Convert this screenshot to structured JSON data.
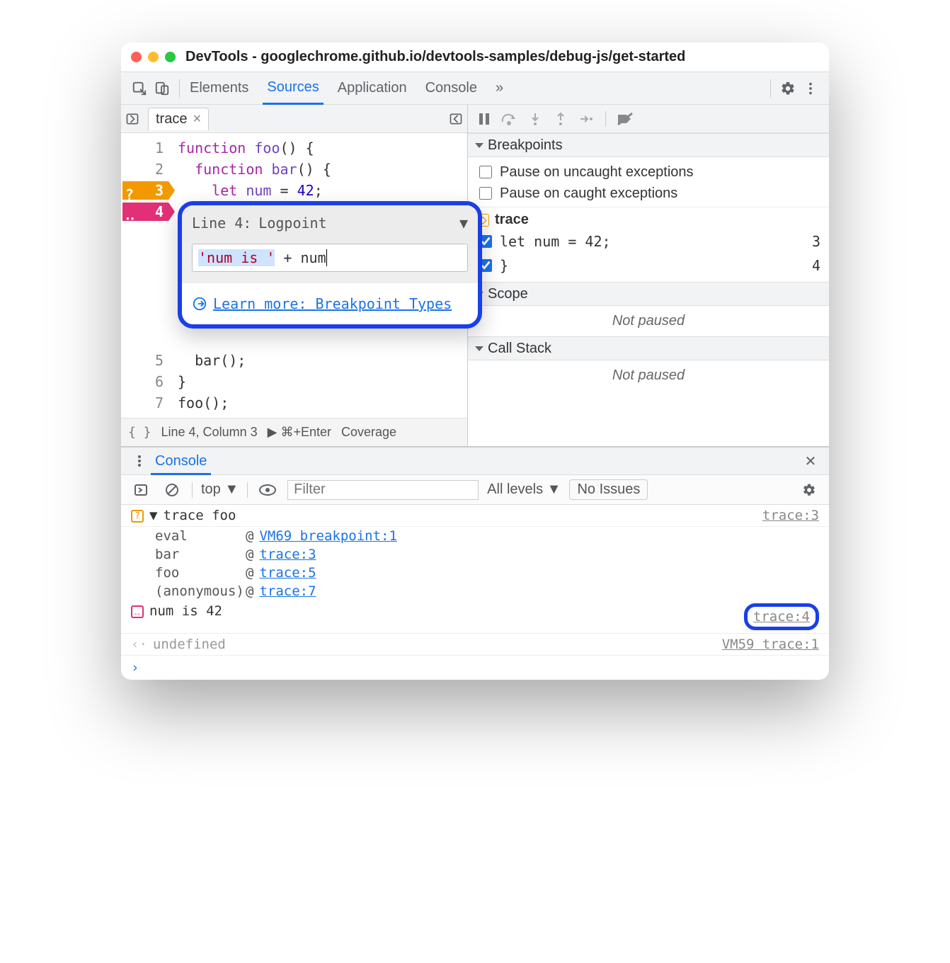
{
  "window": {
    "title": "DevTools - googlechrome.github.io/devtools-samples/debug-js/get-started"
  },
  "top_tabs": {
    "elements": "Elements",
    "sources": "Sources",
    "application": "Application",
    "console": "Console"
  },
  "file_tab": {
    "name": "trace"
  },
  "code": {
    "lines": [
      "1",
      "2",
      "3",
      "4",
      "5",
      "6",
      "7"
    ],
    "l1_kw": "function ",
    "l1_fn": "foo",
    "l1_rest": "() {",
    "l2_kw": "function ",
    "l2_fn": "bar",
    "l2_rest": "() {",
    "l3_kw": "let ",
    "l3_id": "num",
    "l3_eq": " = ",
    "l3_num": "42",
    "l3_semi": ";",
    "l4": "  }",
    "l5": "  bar();",
    "l6": "}",
    "l7": "foo();"
  },
  "popover": {
    "prefix": "Line 4:",
    "type": "Logpoint",
    "input_literal": "'num is '",
    "input_rest": " + num",
    "learn": "Learn more: Breakpoint Types"
  },
  "statusbar": {
    "pos": "Line 4, Column 3",
    "run": "⌘+Enter",
    "cov": "Coverage"
  },
  "sections": {
    "breakpoints": "Breakpoints",
    "pause_uncaught": "Pause on uncaught exceptions",
    "pause_caught": "Pause on caught exceptions",
    "file": "trace",
    "bp1_code": "let num = 42;",
    "bp1_line": "3",
    "bp2_code": "}",
    "bp2_line": "4",
    "scope": "Scope",
    "callstack": "Call Stack",
    "notpaused": "Not paused"
  },
  "console": {
    "tab": "Console",
    "context": "top",
    "filter_ph": "Filter",
    "levels": "All levels",
    "issues": "No Issues",
    "trace_label": "trace foo",
    "trace_src": "trace:3",
    "stack": [
      {
        "fn": "eval",
        "src": "VM69 breakpoint:1"
      },
      {
        "fn": "bar",
        "src": "trace:3"
      },
      {
        "fn": "foo",
        "src": "trace:5"
      },
      {
        "fn": "(anonymous)",
        "src": "trace:7"
      }
    ],
    "log_msg": "num is 42",
    "log_src": "trace:4",
    "undef": "undefined",
    "undef_src": "VM59 trace:1"
  }
}
